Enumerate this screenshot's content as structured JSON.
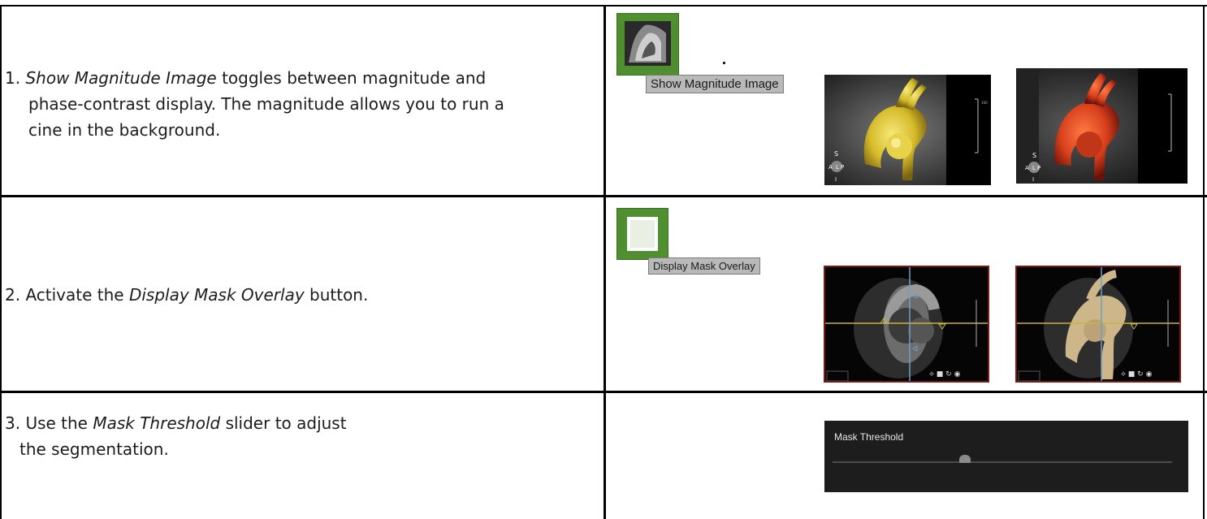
{
  "steps": [
    {
      "number": "1.",
      "line1_term": "Show Magnitude Image",
      "line1_rest": " toggles between magnitude and",
      "line2": "phase-contrast display. The magnitude allows you to run a",
      "line3": "cine in the background.",
      "button_tooltip": "Show Magnitude Image",
      "icon": "magnitude-image-icon"
    },
    {
      "prefix": "2. Activate the ",
      "term": "Display Mask Overlay",
      "suffix": " button.",
      "button_tooltip": "Display Mask Overlay",
      "icon": "mask-overlay-icon"
    },
    {
      "prefix": "3. Use the ",
      "term": "Mask Threshold",
      "suffix": " slider to adjust",
      "line2": "the segmentation.",
      "panel_label": "Mask Threshold",
      "slider_value_fraction": 0.39
    }
  ],
  "viewer_orientation_labels": {
    "s": "S",
    "a": "A",
    "l": "L",
    "p": "P",
    "i": "I"
  },
  "colors": {
    "button_green": "#4f8f2f",
    "magnitude_render": "#e3cf3a",
    "phase_render": "#d8401c",
    "crosshair_yellow": "#c8b43c",
    "crosshair_blue": "#6fa0c8",
    "viewer_border_red": "#7a1a14"
  }
}
